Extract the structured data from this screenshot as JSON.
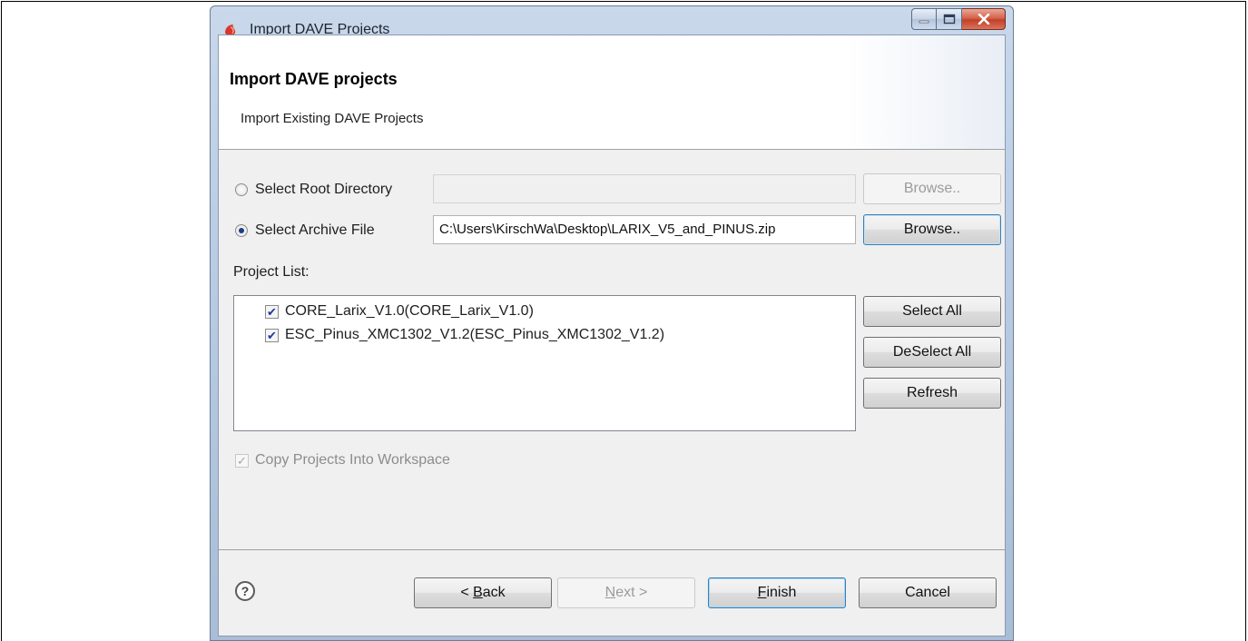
{
  "window": {
    "title": "Import DAVE Projects"
  },
  "header": {
    "title": "Import DAVE projects",
    "subtitle": "Import Existing DAVE Projects"
  },
  "source": {
    "root_directory_label": "Select Root Directory",
    "root_directory_value": "",
    "root_directory_selected": false,
    "archive_file_label": "Select Archive File",
    "archive_file_value": "C:\\Users\\KirschWa\\Desktop\\LARIX_V5_and_PINUS.zip",
    "archive_file_selected": true,
    "browse_label": "Browse.."
  },
  "project_list": {
    "label": "Project List:",
    "items": [
      {
        "label": "CORE_Larix_V1.0(CORE_Larix_V1.0)",
        "checked": true
      },
      {
        "label": "ESC_Pinus_XMC1302_V1.2(ESC_Pinus_XMC1302_V1.2)",
        "checked": true
      }
    ],
    "select_all_label": "Select All",
    "deselect_all_label": "DeSelect All",
    "refresh_label": "Refresh"
  },
  "options": {
    "copy_into_workspace_label": "Copy Projects Into Workspace",
    "copy_into_workspace_checked": true
  },
  "footer": {
    "help_glyph": "?",
    "back_prefix": "< ",
    "back_mnemonic": "B",
    "back_rest": "ack",
    "next_mnemonic": "N",
    "next_rest": "ext >",
    "finish_mnemonic": "F",
    "finish_rest": "inish",
    "cancel_label": "Cancel"
  }
}
